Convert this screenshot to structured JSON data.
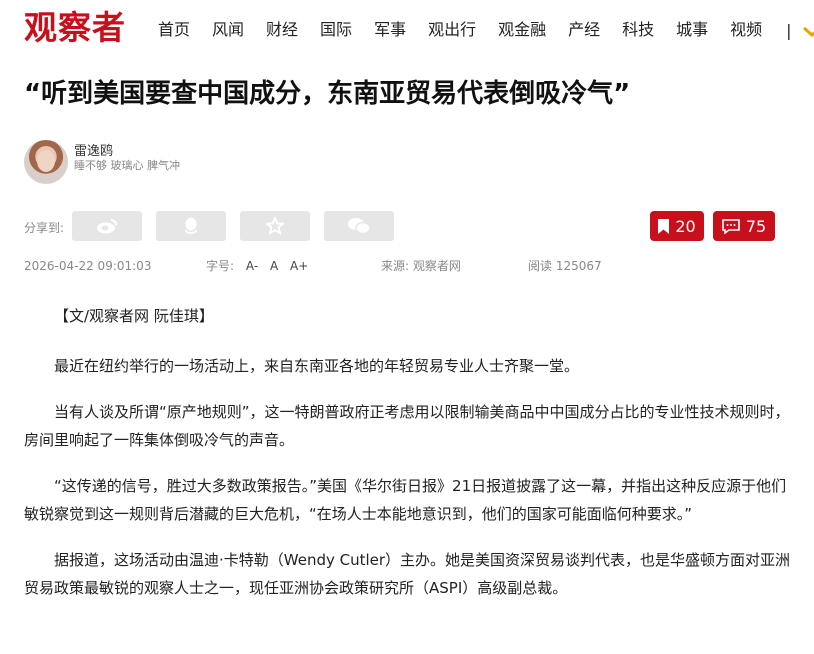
{
  "site": {
    "logo_text": "观察者"
  },
  "nav": {
    "items": [
      "首页",
      "风闻",
      "财经",
      "国际",
      "军事",
      "观出行",
      "观金融",
      "产经",
      "科技",
      "城事",
      "视频"
    ],
    "separator": "|"
  },
  "article": {
    "title": "“听到美国要查中国成分，东南亚贸易代表倒吸冷气”",
    "author_name": "雷逸鸥",
    "author_bio": "睡不够 玻璃心 脾气冲",
    "share_label": "分享到:",
    "share_icons": [
      "weibo-icon",
      "qq-icon",
      "star-icon",
      "wechat-icon"
    ],
    "favorites_count": "20",
    "comments_count": "75",
    "date": "2026-04-22 09:01:03",
    "font_size_label": "字号:",
    "font_size_options": [
      "A-",
      "A",
      "A+"
    ],
    "source_label": "来源:",
    "source_value": "观察者网",
    "views_label": "阅读",
    "views_value": "125067",
    "paragraphs": [
      "【文/观察者网 阮佳琪】",
      "最近在纽约举行的一场活动上，来自东南亚各地的年轻贸易专业人士齐聚一堂。",
      "当有人谈及所谓“原产地规则”，这一特朗普政府正考虑用以限制输美商品中中国成分占比的专业性技术规则时，房间里响起了一阵集体倒吸冷气的声音。",
      "“这传递的信号，胜过大多数政策报告。”美国《华尔街日报》21日报道披露了这一幕，并指出这种反应源于他们敏锐察觉到这一规则背后潜藏的巨大危机，“在场人士本能地意识到，他们的国家可能面临何种要求。”",
      "据报道，这场活动由温迪·卡特勒（Wendy Cutler）主办。她是美国资深贸易谈判代表，也是华盛顿方面对亚洲贸易政策最敏锐的观察人士之一，现任亚洲协会政策研究所（ASPI）高级副总裁。"
    ]
  },
  "colors": {
    "brand_red": "#c8101c",
    "share_bg": "#e6e6e6",
    "meta_gray": "#888888"
  }
}
